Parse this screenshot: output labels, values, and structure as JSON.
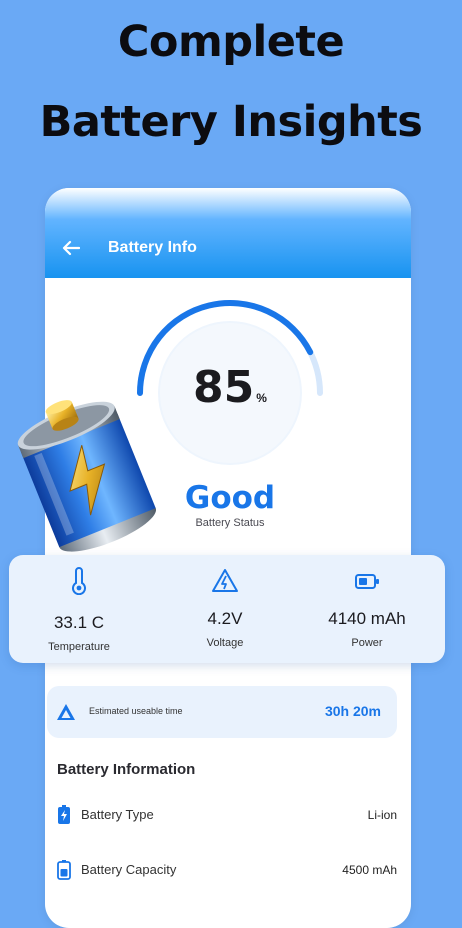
{
  "headline": {
    "line1": "Complete",
    "line2": "Battery Insights"
  },
  "appbar": {
    "title": "Battery Info",
    "back_icon": "arrow-left-icon"
  },
  "gauge": {
    "level_percent": 85,
    "value": "85",
    "unit": "%",
    "status": "Good",
    "status_caption": "Battery Status",
    "arc_color": "#1976e8"
  },
  "stats": {
    "temperature": {
      "value": "33.1 C",
      "label": "Temperature",
      "icon": "thermometer-icon"
    },
    "voltage": {
      "value": "4.2V",
      "label": "Voltage",
      "icon": "warning-triangle-icon"
    },
    "power": {
      "value": "4140 mAh",
      "label": "Power",
      "icon": "battery-icon"
    }
  },
  "estimate": {
    "label": "Estimated useable time",
    "value": "30h 20m",
    "icon": "drive-triangle-icon"
  },
  "battery_information": {
    "title": "Battery Information",
    "rows": [
      {
        "label": "Battery Type",
        "value": "Li-ion",
        "icon": "battery-charge-icon"
      },
      {
        "label": "Battery Capacity",
        "value": "4500 mAh",
        "icon": "battery-icon"
      }
    ]
  },
  "colors": {
    "background": "#6aa9f5",
    "accent": "#1976e8",
    "card": "#e9f2fd"
  }
}
